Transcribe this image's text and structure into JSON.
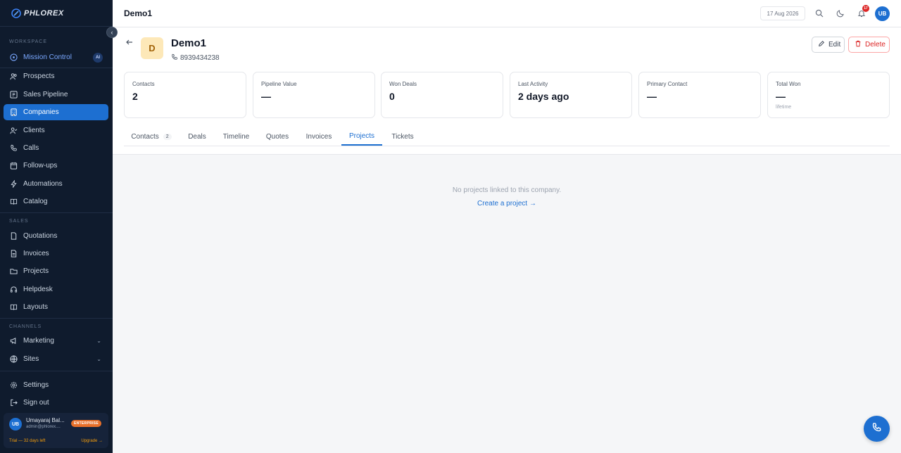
{
  "brand": {
    "logo_text": "PHLOREX"
  },
  "sidebar": {
    "workspace_label": "WORKSPACE",
    "workspace_items": [
      {
        "label": "Mission Control",
        "icon": "target-icon",
        "badge": "AI"
      },
      {
        "label": "Prospects",
        "icon": "users-icon"
      },
      {
        "label": "Sales Pipeline",
        "icon": "pipeline-icon"
      },
      {
        "label": "Companies",
        "icon": "building-icon"
      },
      {
        "label": "Clients",
        "icon": "user-check-icon"
      },
      {
        "label": "Calls",
        "icon": "phone-icon"
      },
      {
        "label": "Follow-ups",
        "icon": "calendar-icon"
      },
      {
        "label": "Automations",
        "icon": "bolt-icon"
      },
      {
        "label": "Catalog",
        "icon": "book-icon"
      }
    ],
    "sales_label": "SALES",
    "sales_items": [
      {
        "label": "Quotations",
        "icon": "file-icon"
      },
      {
        "label": "Invoices",
        "icon": "invoice-icon"
      },
      {
        "label": "Projects",
        "icon": "folder-icon"
      },
      {
        "label": "Helpdesk",
        "icon": "headset-icon"
      },
      {
        "label": "Layouts",
        "icon": "layout-icon"
      }
    ],
    "channels_label": "CHANNELS",
    "channels_items": [
      {
        "label": "Marketing",
        "icon": "megaphone-icon"
      },
      {
        "label": "Sites",
        "icon": "globe-icon"
      }
    ],
    "settings_label": "Settings",
    "signout_label": "Sign out",
    "user": {
      "initials": "UB",
      "name": "Umayaraj Bal...",
      "email": "admin@phlorex....",
      "plan": "ENTERPRISE",
      "trial": "Trial — 32 days left",
      "upgrade": "Upgrade →"
    }
  },
  "header": {
    "title": "Demo1",
    "date": "17 Aug 2026",
    "notif_count": "17",
    "user_initials": "UB"
  },
  "company": {
    "initial": "D",
    "name": "Demo1",
    "phone": "8939434238",
    "edit_label": "Edit",
    "delete_label": "Delete"
  },
  "stats": [
    {
      "label": "Contacts",
      "value": "2",
      "sub": ""
    },
    {
      "label": "Pipeline Value",
      "value": "—",
      "sub": ""
    },
    {
      "label": "Won Deals",
      "value": "0",
      "sub": ""
    },
    {
      "label": "Last Activity",
      "value": "2 days ago",
      "sub": ""
    },
    {
      "label": "Primary Contact",
      "value": "—",
      "sub": ""
    },
    {
      "label": "Total Won",
      "value": "—",
      "sub": "lifetime"
    }
  ],
  "tabs": [
    {
      "label": "Contacts",
      "count": "2"
    },
    {
      "label": "Deals"
    },
    {
      "label": "Timeline"
    },
    {
      "label": "Quotes"
    },
    {
      "label": "Invoices"
    },
    {
      "label": "Projects"
    },
    {
      "label": "Tickets"
    }
  ],
  "active_tab": "Projects",
  "empty_state": {
    "message": "No projects linked to this company.",
    "action": "Create a project →"
  },
  "colors": {
    "sidebar_bg": "#0f1b2d",
    "accent": "#1d6fd1",
    "danger": "#dc2626",
    "enterprise_badge": "#e8702a"
  }
}
